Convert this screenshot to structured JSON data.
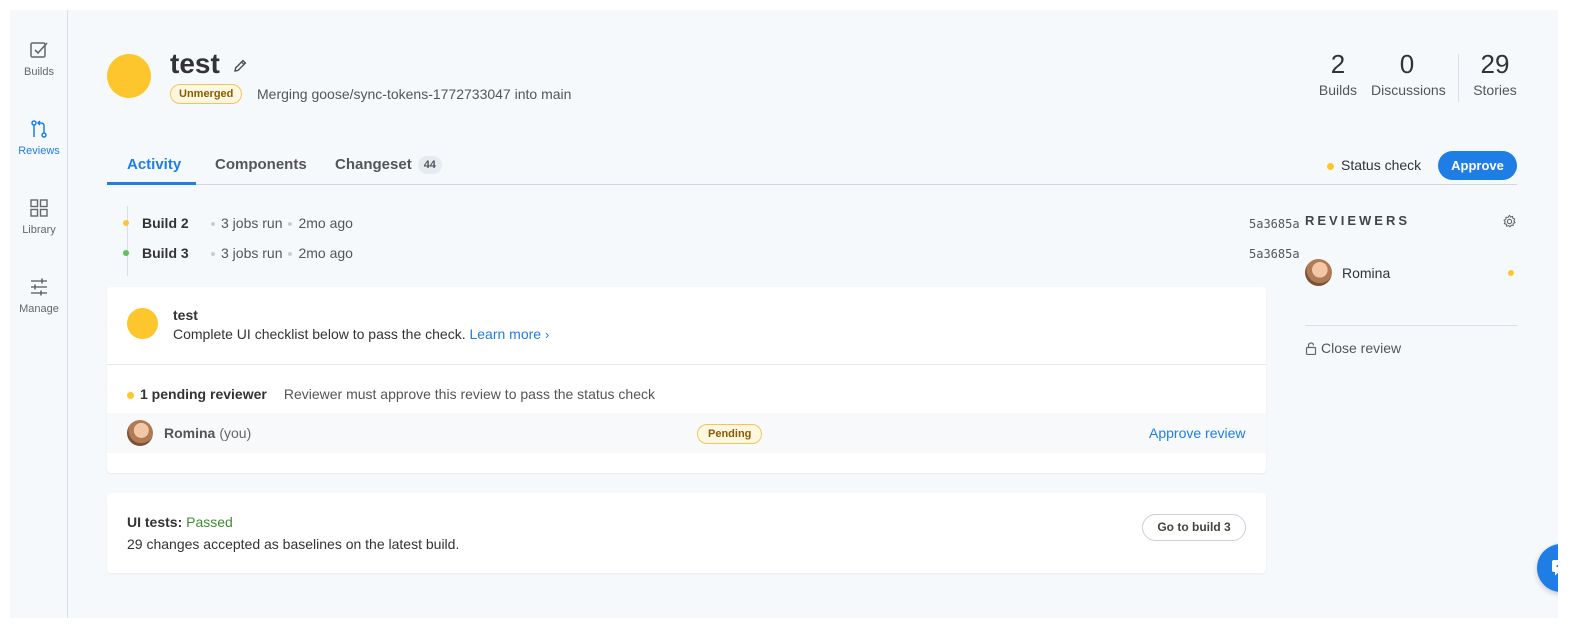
{
  "sidebar": {
    "items": [
      {
        "label": "Builds",
        "icon": "checkbox-icon",
        "active": false
      },
      {
        "label": "Reviews",
        "icon": "pull-request-icon",
        "active": true
      },
      {
        "label": "Library",
        "icon": "grid-icon",
        "active": false
      },
      {
        "label": "Manage",
        "icon": "sliders-icon",
        "active": false
      }
    ]
  },
  "header": {
    "title": "test",
    "badge": "Unmerged",
    "description": "Merging goose/sync-tokens-1772733047 into main",
    "stats": [
      {
        "value": "2",
        "label": "Builds"
      },
      {
        "value": "0",
        "label": "Discussions"
      },
      {
        "value": "29",
        "label": "Stories"
      }
    ]
  },
  "tabs": [
    {
      "label": "Activity",
      "active": true
    },
    {
      "label": "Components",
      "active": false
    },
    {
      "label": "Changeset",
      "count": "44",
      "active": false
    }
  ],
  "status_check": {
    "label": "Status check",
    "status_color": "#fdc62d"
  },
  "approve_button": "Approve",
  "builds": [
    {
      "name": "Build 2",
      "jobs": "3 jobs run",
      "time": "2mo ago",
      "sha": "5a3685a",
      "status_color": "#fdc62d"
    },
    {
      "name": "Build 3",
      "jobs": "3 jobs run",
      "time": "2mo ago",
      "sha": "5a3685a",
      "status_color": "#5cc35a"
    }
  ],
  "status_card": {
    "title": "test",
    "description": "Complete UI checklist below to pass the check.",
    "link": "Learn more",
    "pending_title": "1 pending reviewer",
    "pending_hint": "Reviewer must approve this review to pass the status check",
    "reviewer": {
      "name": "Romina",
      "you": "(you)",
      "status": "Pending",
      "action": "Approve review"
    }
  },
  "ui_tests": {
    "label": "UI tests:",
    "status": "Passed",
    "description": "29 changes accepted as baselines on the latest build.",
    "button": "Go to build 3"
  },
  "reviewers_panel": {
    "heading": "REVIEWERS",
    "reviewers": [
      {
        "name": "Romina",
        "status_color": "#fdc62d"
      }
    ],
    "close_review": "Close review"
  },
  "colors": {
    "accent": "#1e7ee6",
    "pending": "#fdc62d",
    "passed": "#3d8f2f"
  }
}
